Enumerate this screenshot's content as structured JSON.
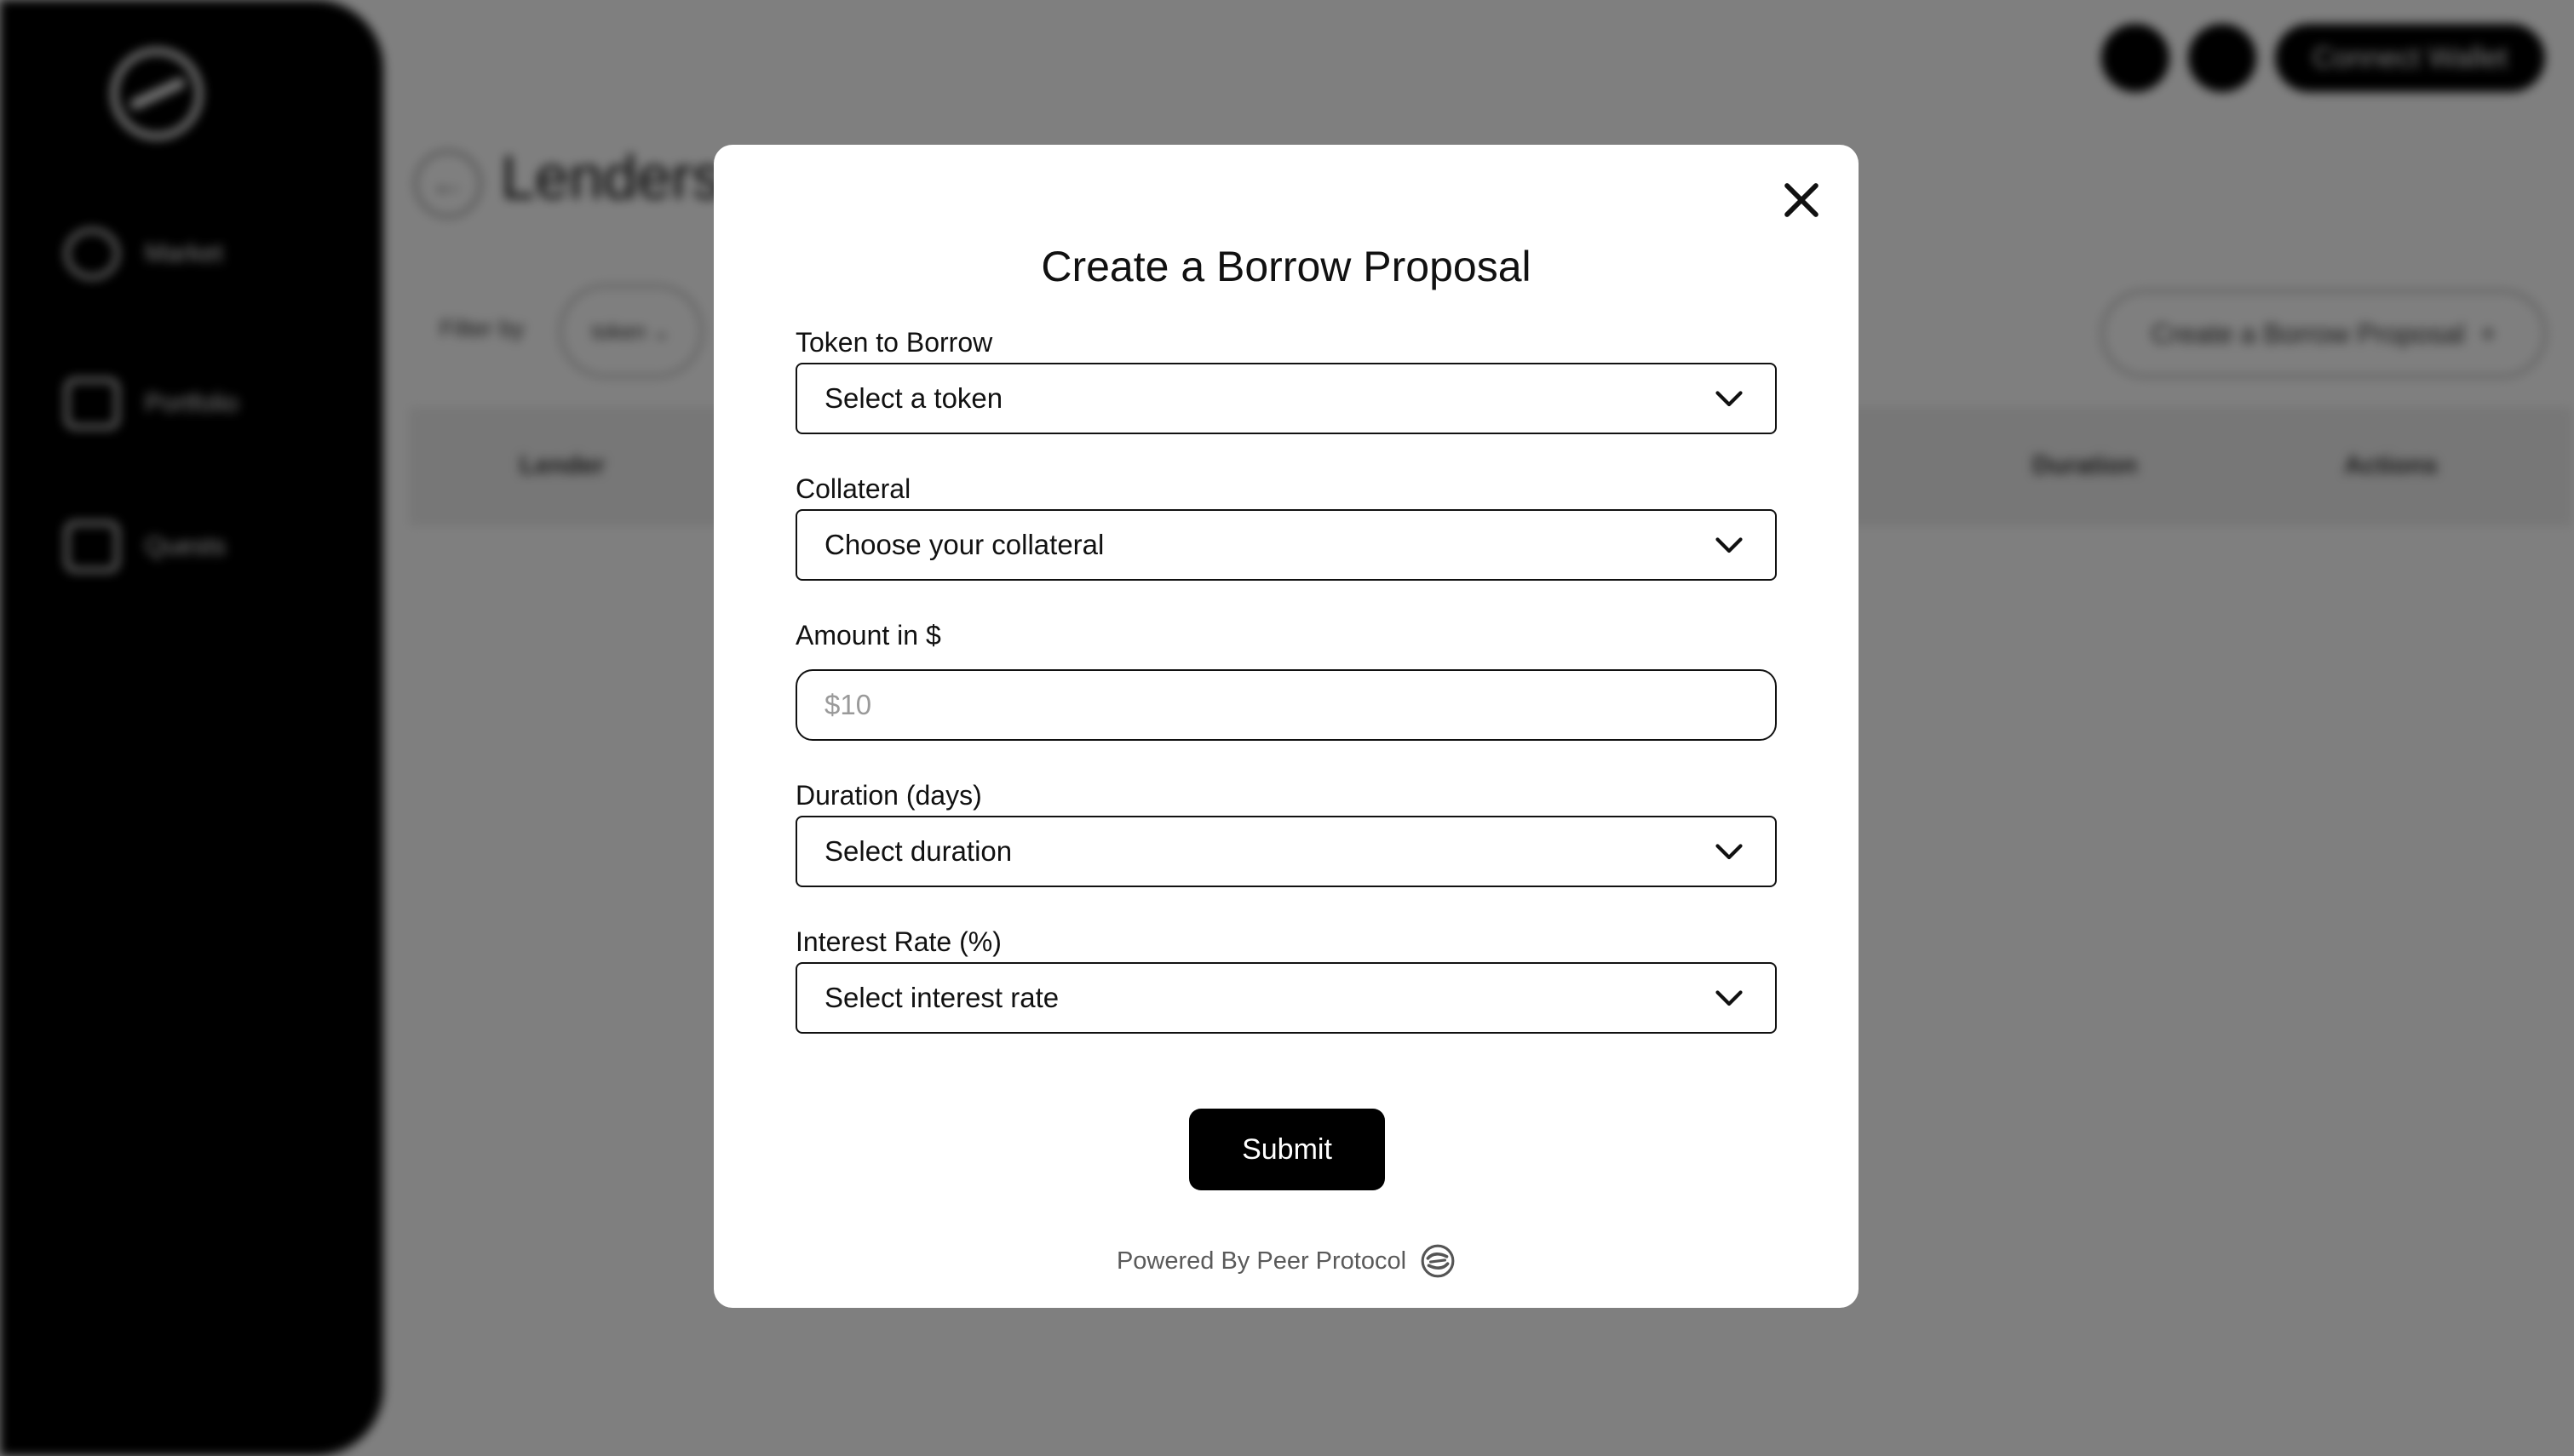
{
  "background": {
    "sidebar": {
      "items": [
        {
          "label": "Market",
          "icon": "market-icon"
        },
        {
          "label": "Portfolio",
          "icon": "folder-icon"
        },
        {
          "label": "Quests",
          "icon": "quests-icon"
        }
      ]
    },
    "topbar": {
      "connect_label": "Connect Wallet"
    },
    "page": {
      "title": "Lenders",
      "back_icon": "←",
      "filter_label": "Filter by",
      "filter_chip": "token ⌄",
      "create_button": "Create a Borrow Proposal",
      "create_icon": "+"
    },
    "table": {
      "headers": [
        "Lender",
        "Duration",
        "Actions"
      ]
    }
  },
  "modal": {
    "title": "Create a Borrow Proposal",
    "fields": {
      "token": {
        "label": "Token to Borrow",
        "value": "Select a token"
      },
      "collateral": {
        "label": "Collateral",
        "value": "Choose your collateral"
      },
      "amount": {
        "label": "Amount in $",
        "placeholder": "$10"
      },
      "duration": {
        "label": "Duration (days)",
        "value": "Select duration"
      },
      "interest": {
        "label": "Interest Rate (%)",
        "value": "Select interest rate"
      }
    },
    "submit_label": "Submit",
    "powered_by": "Powered By Peer Protocol"
  }
}
